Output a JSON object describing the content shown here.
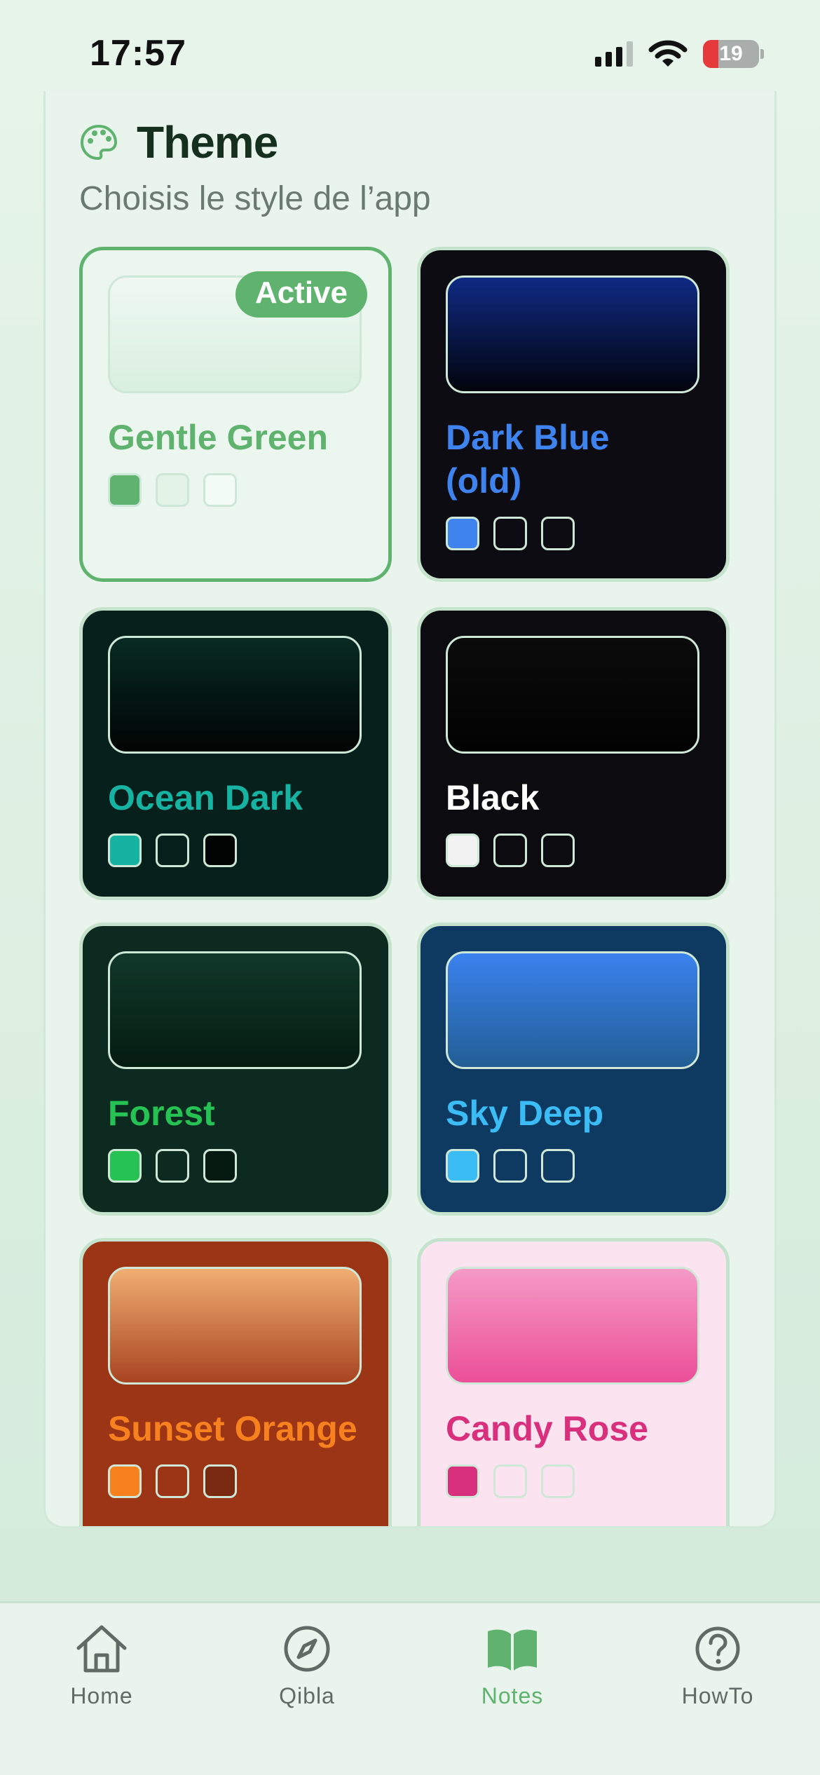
{
  "status_bar": {
    "time": "17:57",
    "battery": "19"
  },
  "settings": {
    "title": "Theme",
    "subtitle": "Choisis le style de l’app",
    "active_badge": "Active",
    "themes": [
      {
        "name": "Gentle Green",
        "name_color": "#5fb36f",
        "bg": "#ebf6ee",
        "preview": [
          "#eef8f1",
          "#d9efe0"
        ],
        "swatches": [
          "#5fb36f",
          "#e4f3e8",
          "#f3fbf5"
        ],
        "active": true
      },
      {
        "name": "Dark Blue (old)",
        "name_color": "#3f83ef",
        "bg": "#0c0c12",
        "preview": [
          "#0f2a84",
          "#02040c"
        ],
        "swatches": [
          "#3f83ef",
          "#0c0c12",
          "#0c0c12"
        ],
        "active": false
      },
      {
        "name": "Ocean Dark",
        "name_color": "#16b3a3",
        "bg": "#07201b",
        "preview": [
          "#072a22",
          "#010403"
        ],
        "swatches": [
          "#16b3a3",
          "#07201b",
          "#020303"
        ],
        "active": false
      },
      {
        "name": "Black",
        "name_color": "#ffffff",
        "bg": "#0c0c10",
        "preview": [
          "#0b0b0b",
          "#020202"
        ],
        "swatches": [
          "#f2f2f2",
          "#0c0c10",
          "#0c0c10"
        ],
        "active": false
      },
      {
        "name": "Forest",
        "name_color": "#26c254",
        "bg": "#0c2a20",
        "preview": [
          "#10382a",
          "#051b12"
        ],
        "swatches": [
          "#26c254",
          "#0c2a20",
          "#061a11"
        ],
        "active": false
      },
      {
        "name": "Sky Deep",
        "name_color": "#3bbcf5",
        "bg": "#0e3960",
        "preview": [
          "#3a82ee",
          "#225e94"
        ],
        "swatches": [
          "#3bbcf5",
          "#0e3960",
          "#0e3960"
        ],
        "active": false
      },
      {
        "name": "Sunset Orange",
        "name_color": "#f7811f",
        "bg": "#9b3516",
        "preview": [
          "#f0ae72",
          "#a84421"
        ],
        "swatches": [
          "#f7811f",
          "#9b3516",
          "#7a2a10"
        ],
        "active": false
      },
      {
        "name": "Candy Rose",
        "name_color": "#d8307c",
        "bg": "#fbe4ef",
        "preview": [
          "#f59ac6",
          "#eb4f97"
        ],
        "swatches": [
          "#d8307c",
          "#fbe4ef",
          "#fbe4ef"
        ],
        "active": false
      }
    ]
  },
  "nav": {
    "items": [
      {
        "label": "Home",
        "icon": "home-icon",
        "active": false
      },
      {
        "label": "Qibla",
        "icon": "compass-icon",
        "active": false
      },
      {
        "label": "Notes",
        "icon": "book-icon",
        "active": true
      },
      {
        "label": "HowTo",
        "icon": "help-circle-icon",
        "active": false
      }
    ],
    "active_color": "#5fb36f",
    "inactive_color": "#5f6b64"
  }
}
